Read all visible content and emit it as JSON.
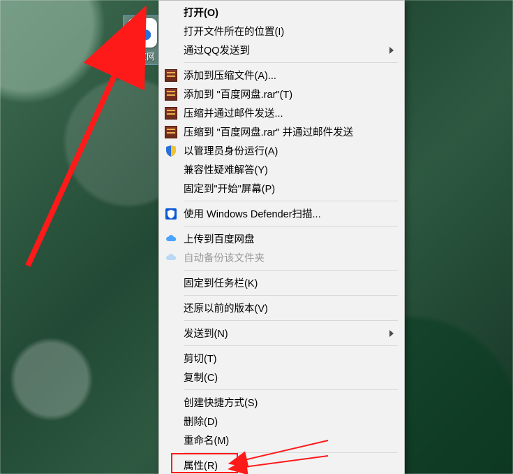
{
  "desktop_icon": {
    "label": "百度网"
  },
  "menu": {
    "open": "打开(O)",
    "open_location": "打开文件所在的位置(I)",
    "qq_send": "通过QQ发送到",
    "rar_add": "添加到压缩文件(A)...",
    "rar_add_named": "添加到 \"百度网盘.rar\"(T)",
    "rar_email": "压缩并通过邮件发送...",
    "rar_named_email": "压缩到 \"百度网盘.rar\" 并通过邮件发送",
    "run_admin": "以管理员身份运行(A)",
    "compat": "兼容性疑难解答(Y)",
    "pin_start": "固定到\"开始\"屏幕(P)",
    "defender": "使用 Windows Defender扫描...",
    "baidu_upload": "上传到百度网盘",
    "baidu_backup": "自动备份该文件夹",
    "pin_taskbar": "固定到任务栏(K)",
    "restore_prev": "还原以前的版本(V)",
    "send_to": "发送到(N)",
    "cut": "剪切(T)",
    "copy": "复制(C)",
    "shortcut": "创建快捷方式(S)",
    "delete": "删除(D)",
    "rename": "重命名(M)",
    "properties": "属性(R)"
  }
}
